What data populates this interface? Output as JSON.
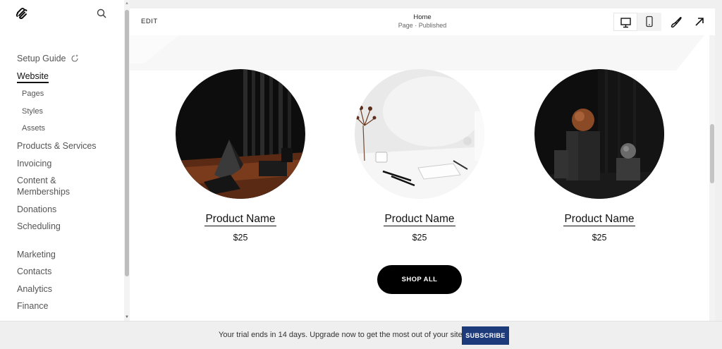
{
  "sidebar": {
    "items": [
      {
        "label": "Setup Guide"
      },
      {
        "label": "Website"
      },
      {
        "label": "Pages"
      },
      {
        "label": "Styles"
      },
      {
        "label": "Assets"
      },
      {
        "label": "Products & Services"
      },
      {
        "label": "Invoicing"
      },
      {
        "label": "Content &"
      },
      {
        "label": "Memberships"
      },
      {
        "label": "Donations"
      },
      {
        "label": "Scheduling"
      },
      {
        "label": "Marketing"
      },
      {
        "label": "Contacts"
      },
      {
        "label": "Analytics"
      },
      {
        "label": "Finance"
      }
    ]
  },
  "topbar": {
    "edit_label": "EDIT",
    "page_title": "Home",
    "page_status": "Page · Published"
  },
  "products": [
    {
      "name": "Product Name",
      "price": "$25"
    },
    {
      "name": "Product Name",
      "price": "$25"
    },
    {
      "name": "Product Name",
      "price": "$25"
    }
  ],
  "shop_all_label": "SHOP ALL",
  "banner": {
    "text": "Your trial ends in 14 days. Upgrade now to get the most out of your site.",
    "subscribe_label": "SUBSCRIBE"
  },
  "colors": {
    "subscribe_bg": "#1d3a7a",
    "shop_all_bg": "#000000"
  },
  "icons": [
    "squarespace-logo-icon",
    "search-icon",
    "sparkle-icon",
    "desktop-icon",
    "mobile-icon",
    "paintbrush-icon",
    "arrow-up-right-icon"
  ]
}
